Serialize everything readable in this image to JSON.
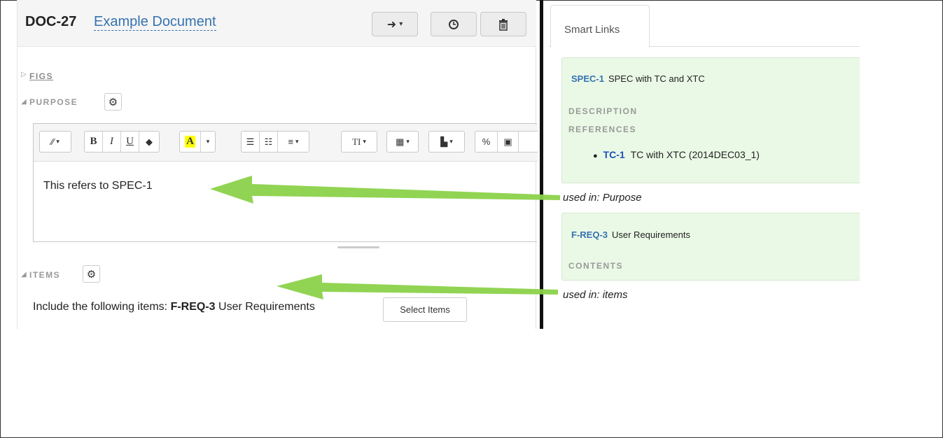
{
  "document": {
    "id": "DOC-27",
    "title": "Example Document",
    "header_buttons": {
      "share_icon": "arrow-right-icon",
      "history_icon": "clock-icon",
      "delete_icon": "trash-icon"
    }
  },
  "sections": {
    "figs": {
      "label": "FIGS"
    },
    "purpose": {
      "label": "PURPOSE",
      "text": "This refers to SPEC-1"
    },
    "items": {
      "label": "ITEMS",
      "text_prefix": "Include the following items:",
      "item_id": "F-REQ-3",
      "item_title": "User Requirements",
      "button": "Select Items"
    }
  },
  "toolbar": {
    "groups": [
      {
        "buttons": [
          {
            "name": "style-dropdown",
            "glyph": "✎ ▾"
          }
        ]
      },
      {
        "buttons": [
          {
            "name": "bold",
            "glyph": "B"
          },
          {
            "name": "italic",
            "glyph": "I"
          },
          {
            "name": "underline",
            "glyph": "U"
          },
          {
            "name": "clear-format",
            "glyph": "⌫"
          }
        ]
      },
      {
        "buttons": [
          {
            "name": "highlight",
            "glyph": "A"
          },
          {
            "name": "highlight-dropdown",
            "glyph": "▾"
          }
        ]
      },
      {
        "buttons": [
          {
            "name": "bullet-list",
            "glyph": "☰"
          },
          {
            "name": "numbered-list",
            "glyph": "☷"
          },
          {
            "name": "align-dropdown",
            "glyph": "≡ ▾"
          }
        ]
      },
      {
        "buttons": [
          {
            "name": "font-size-dropdown",
            "glyph": "TI ▾"
          }
        ]
      },
      {
        "buttons": [
          {
            "name": "table-dropdown",
            "glyph": "▦ ▾"
          }
        ]
      },
      {
        "buttons": [
          {
            "name": "paste-dropdown",
            "glyph": "📋 ▾"
          }
        ]
      },
      {
        "buttons": [
          {
            "name": "link",
            "glyph": "🔗"
          },
          {
            "name": "image",
            "glyph": "▣"
          }
        ]
      }
    ]
  },
  "smart_links": {
    "tab": "Smart Links",
    "cards": [
      {
        "id": "SPEC-1",
        "title": "SPEC with TC and XTC",
        "sections": [
          "DESCRIPTION",
          "REFERENCES"
        ],
        "references": [
          {
            "id": "TC-1",
            "title": "TC with XTC (2014DEC03_1)"
          }
        ],
        "used_in": "used in: Purpose"
      },
      {
        "id": "F-REQ-3",
        "title": "User Requirements",
        "sections": [
          "CONTENTS"
        ],
        "used_in": "used in: items"
      }
    ]
  },
  "colors": {
    "arrow": "#8bd24a",
    "card_bg": "#eaf9e6",
    "link_blue": "#3572b0"
  }
}
